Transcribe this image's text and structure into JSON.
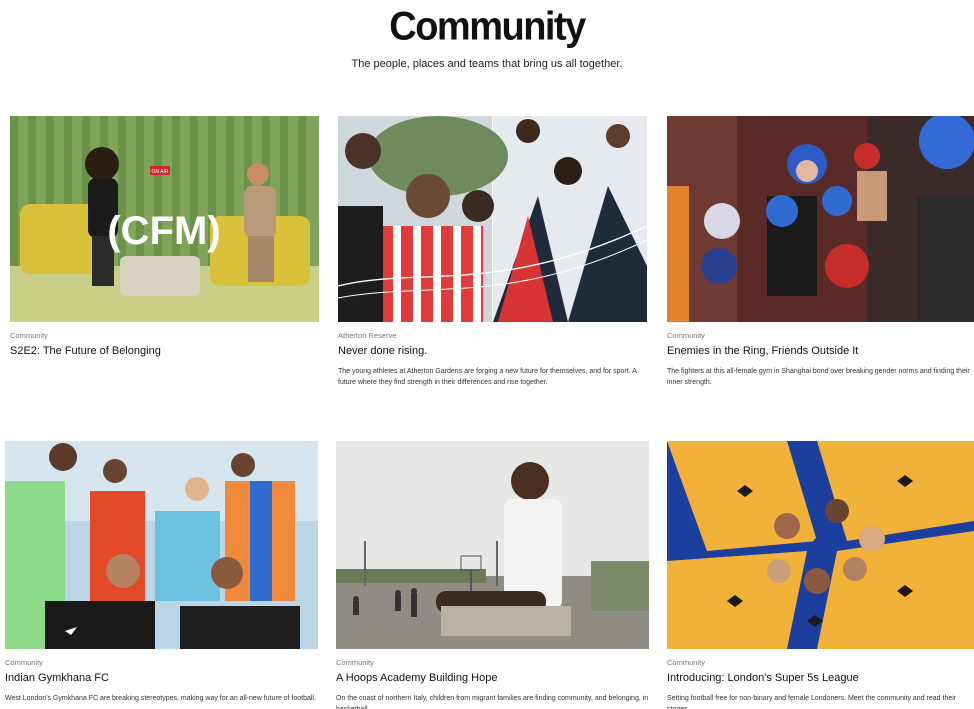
{
  "page": {
    "title": "Community",
    "subtitle": "The people, places and teams that bring us all together."
  },
  "cards": [
    {
      "tag": "Community",
      "title": "S2E2: The Future of Belonging",
      "description": "",
      "image_overlay": "(CFM)",
      "image_badge": "ON AIR"
    },
    {
      "tag": "Atherton Reserve",
      "title": "Never done rising.",
      "description": "The young athletes at Atherton Gardens are forging a new future for themselves, and for sport. A future where they find strength in their differences and rise together."
    },
    {
      "tag": "Community",
      "title": "Enemies in the Ring, Friends Outside It",
      "description": "The fighters at this all-female gym in Shanghai bond over breaking gender norms and finding their inner strength."
    },
    {
      "tag": "Community",
      "title": "Indian Gymkhana FC",
      "description": "West London's Gymkhana FC are breaking stereotypes, making way for an all-new future of football."
    },
    {
      "tag": "Community",
      "title": "A Hoops Academy Building Hope",
      "description": "On the coast of northern Italy, children from migrant families are finding community, and belonging, in basketball."
    },
    {
      "tag": "Community",
      "title": "Introducing: London's Super 5s League",
      "description": "Setting football free for non-binary and female Londoners. Meet the community and read their stories."
    }
  ],
  "colors": {
    "text": "#111111",
    "muted": "#777777",
    "background": "#ffffff"
  }
}
